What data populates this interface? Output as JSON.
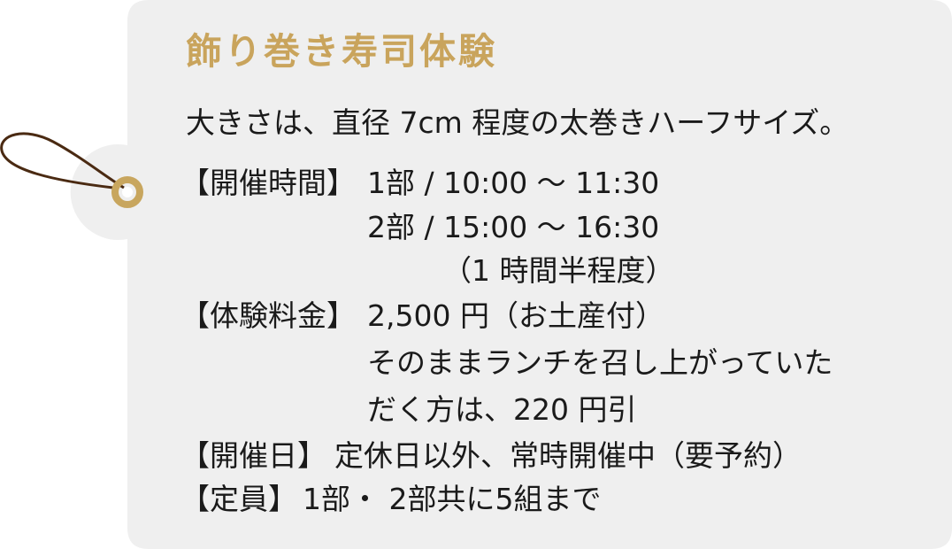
{
  "colors": {
    "card_background": "#efefef",
    "title_gold": "#c9a45c",
    "eyelet_gold": "#c8a65e",
    "string_brown": "#4a2a12",
    "text": "#1a1a1a"
  },
  "card": {
    "title": "飾り巻き寿司体験",
    "description": "大きさは、直径 7cm 程度の太巻きハーフサイズ。",
    "schedule": {
      "label": "【開催時間】",
      "session1": "1部 / 10:00 〜 11:30",
      "session2": "2部 / 15:00 〜 16:30",
      "duration": "（1 時間半程度）"
    },
    "fee": {
      "label": "【体験料金】",
      "price": "2,500 円（お土産付）",
      "note_line1": "そのままランチを召し上がっていた",
      "note_line2": "だく方は、220 円引"
    },
    "dates": {
      "label": "【開催日】",
      "value": "定休日以外、常時開催中（要予約）"
    },
    "capacity": {
      "label": "【定員】",
      "value": "1部・ 2部共に5組まで"
    }
  }
}
